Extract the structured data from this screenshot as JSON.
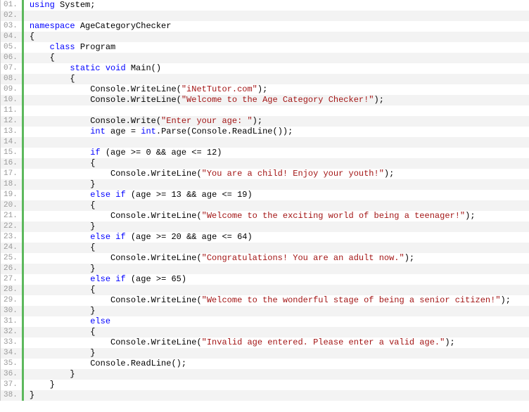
{
  "chart_data": {
    "type": "code",
    "language": "csharp",
    "lines": [
      {
        "n": "01.",
        "tokens": [
          [
            "kw",
            "using"
          ],
          [
            "plain",
            " System;"
          ]
        ]
      },
      {
        "n": "02.",
        "tokens": []
      },
      {
        "n": "03.",
        "tokens": [
          [
            "kw",
            "namespace"
          ],
          [
            "plain",
            " AgeCategoryChecker"
          ]
        ]
      },
      {
        "n": "04.",
        "tokens": [
          [
            "plain",
            "{"
          ]
        ]
      },
      {
        "n": "05.",
        "tokens": [
          [
            "plain",
            "    "
          ],
          [
            "kw",
            "class"
          ],
          [
            "plain",
            " Program"
          ]
        ]
      },
      {
        "n": "06.",
        "tokens": [
          [
            "plain",
            "    {"
          ]
        ]
      },
      {
        "n": "07.",
        "tokens": [
          [
            "plain",
            "        "
          ],
          [
            "kw",
            "static"
          ],
          [
            "plain",
            " "
          ],
          [
            "kw",
            "void"
          ],
          [
            "plain",
            " Main()"
          ]
        ]
      },
      {
        "n": "08.",
        "tokens": [
          [
            "plain",
            "        {"
          ]
        ]
      },
      {
        "n": "09.",
        "tokens": [
          [
            "plain",
            "            Console.WriteLine("
          ],
          [
            "str",
            "\"iNetTutor.com\""
          ],
          [
            "plain",
            ");"
          ]
        ]
      },
      {
        "n": "10.",
        "tokens": [
          [
            "plain",
            "            Console.WriteLine("
          ],
          [
            "str",
            "\"Welcome to the Age Category Checker!\""
          ],
          [
            "plain",
            ");"
          ]
        ]
      },
      {
        "n": "11.",
        "tokens": []
      },
      {
        "n": "12.",
        "tokens": [
          [
            "plain",
            "            Console.Write("
          ],
          [
            "str",
            "\"Enter your age: \""
          ],
          [
            "plain",
            ");"
          ]
        ]
      },
      {
        "n": "13.",
        "tokens": [
          [
            "plain",
            "            "
          ],
          [
            "kw",
            "int"
          ],
          [
            "plain",
            " age = "
          ],
          [
            "kw",
            "int"
          ],
          [
            "plain",
            ".Parse(Console.ReadLine());"
          ]
        ]
      },
      {
        "n": "14.",
        "tokens": []
      },
      {
        "n": "15.",
        "tokens": [
          [
            "plain",
            "            "
          ],
          [
            "kw",
            "if"
          ],
          [
            "plain",
            " (age >= 0 && age <= 12)"
          ]
        ]
      },
      {
        "n": "16.",
        "tokens": [
          [
            "plain",
            "            {"
          ]
        ]
      },
      {
        "n": "17.",
        "tokens": [
          [
            "plain",
            "                Console.WriteLine("
          ],
          [
            "str",
            "\"You are a child! Enjoy your youth!\""
          ],
          [
            "plain",
            ");"
          ]
        ]
      },
      {
        "n": "18.",
        "tokens": [
          [
            "plain",
            "            }"
          ]
        ]
      },
      {
        "n": "19.",
        "tokens": [
          [
            "plain",
            "            "
          ],
          [
            "kw",
            "else"
          ],
          [
            "plain",
            " "
          ],
          [
            "kw",
            "if"
          ],
          [
            "plain",
            " (age >= 13 && age <= 19)"
          ]
        ]
      },
      {
        "n": "20.",
        "tokens": [
          [
            "plain",
            "            {"
          ]
        ]
      },
      {
        "n": "21.",
        "tokens": [
          [
            "plain",
            "                Console.WriteLine("
          ],
          [
            "str",
            "\"Welcome to the exciting world of being a teenager!\""
          ],
          [
            "plain",
            ");"
          ]
        ]
      },
      {
        "n": "22.",
        "tokens": [
          [
            "plain",
            "            }"
          ]
        ]
      },
      {
        "n": "23.",
        "tokens": [
          [
            "plain",
            "            "
          ],
          [
            "kw",
            "else"
          ],
          [
            "plain",
            " "
          ],
          [
            "kw",
            "if"
          ],
          [
            "plain",
            " (age >= 20 && age <= 64)"
          ]
        ]
      },
      {
        "n": "24.",
        "tokens": [
          [
            "plain",
            "            {"
          ]
        ]
      },
      {
        "n": "25.",
        "tokens": [
          [
            "plain",
            "                Console.WriteLine("
          ],
          [
            "str",
            "\"Congratulations! You are an adult now.\""
          ],
          [
            "plain",
            ");"
          ]
        ]
      },
      {
        "n": "26.",
        "tokens": [
          [
            "plain",
            "            }"
          ]
        ]
      },
      {
        "n": "27.",
        "tokens": [
          [
            "plain",
            "            "
          ],
          [
            "kw",
            "else"
          ],
          [
            "plain",
            " "
          ],
          [
            "kw",
            "if"
          ],
          [
            "plain",
            " (age >= 65)"
          ]
        ]
      },
      {
        "n": "28.",
        "tokens": [
          [
            "plain",
            "            {"
          ]
        ]
      },
      {
        "n": "29.",
        "tokens": [
          [
            "plain",
            "                Console.WriteLine("
          ],
          [
            "str",
            "\"Welcome to the wonderful stage of being a senior citizen!\""
          ],
          [
            "plain",
            ");"
          ]
        ]
      },
      {
        "n": "30.",
        "tokens": [
          [
            "plain",
            "            }"
          ]
        ]
      },
      {
        "n": "31.",
        "tokens": [
          [
            "plain",
            "            "
          ],
          [
            "kw",
            "else"
          ]
        ]
      },
      {
        "n": "32.",
        "tokens": [
          [
            "plain",
            "            {"
          ]
        ]
      },
      {
        "n": "33.",
        "tokens": [
          [
            "plain",
            "                Console.WriteLine("
          ],
          [
            "str",
            "\"Invalid age entered. Please enter a valid age.\""
          ],
          [
            "plain",
            ");"
          ]
        ]
      },
      {
        "n": "34.",
        "tokens": [
          [
            "plain",
            "            }"
          ]
        ]
      },
      {
        "n": "35.",
        "tokens": [
          [
            "plain",
            "            Console.ReadLine();"
          ]
        ]
      },
      {
        "n": "36.",
        "tokens": [
          [
            "plain",
            "        }"
          ]
        ]
      },
      {
        "n": "37.",
        "tokens": [
          [
            "plain",
            "    }"
          ]
        ]
      },
      {
        "n": "38.",
        "tokens": [
          [
            "plain",
            "}"
          ]
        ]
      }
    ]
  }
}
